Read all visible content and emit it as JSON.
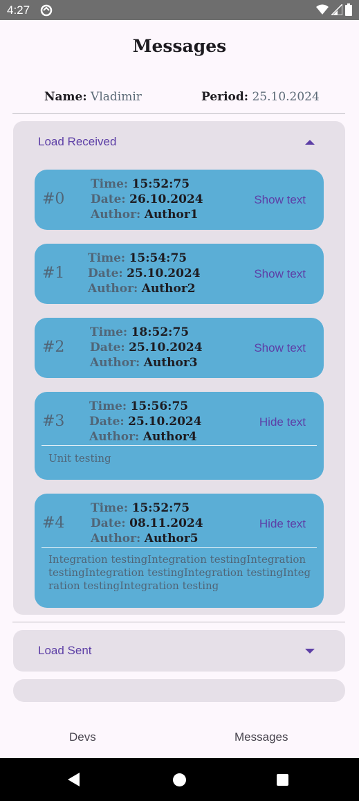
{
  "status_bar": {
    "time": "4:27",
    "icons": [
      "sync-icon",
      "wifi-icon",
      "signal-icon",
      "battery-icon"
    ]
  },
  "header": {
    "title": "Messages"
  },
  "info": {
    "name_label": "Name:",
    "name_value": "Vladimir",
    "period_label": "Period:",
    "period_value": "25.10.2024"
  },
  "received": {
    "title": "Load Received",
    "expanded": true,
    "items": [
      {
        "index": "#0",
        "time_label": "Time:",
        "time": "15:52:75",
        "date_label": "Date:",
        "date": "26.10.2024",
        "author_label": "Author:",
        "author": "Author1",
        "action": "Show text"
      },
      {
        "index": "#1",
        "time_label": "Time:",
        "time": "15:54:75",
        "date_label": "Date:",
        "date": "25.10.2024",
        "author_label": "Author:",
        "author": "Author2",
        "action": "Show text"
      },
      {
        "index": "#2",
        "time_label": "Time:",
        "time": "18:52:75",
        "date_label": "Date:",
        "date": "25.10.2024",
        "author_label": "Author:",
        "author": "Author3",
        "action": "Show text"
      },
      {
        "index": "#3",
        "time_label": "Time:",
        "time": "15:56:75",
        "date_label": "Date:",
        "date": "25.10.2024",
        "author_label": "Author:",
        "author": "Author4",
        "action": "Hide text",
        "text": "Unit testing"
      },
      {
        "index": "#4",
        "time_label": "Time:",
        "time": "15:52:75",
        "date_label": "Date:",
        "date": "08.11.2024",
        "author_label": "Author:",
        "author": "Author5",
        "action": "Hide text",
        "text": "Integration testingIntegration testingIntegration testingIntegration testingIntegration testingIntegration testingIntegration testing"
      }
    ]
  },
  "sent": {
    "title": "Load Sent",
    "expanded": false
  },
  "bottom_nav": {
    "devs": "Devs",
    "messages": "Messages"
  },
  "colors": {
    "accent": "#5d3fa6",
    "card": "#5baed6",
    "panel": "#e6e0e8",
    "background": "#fdf7fd"
  }
}
